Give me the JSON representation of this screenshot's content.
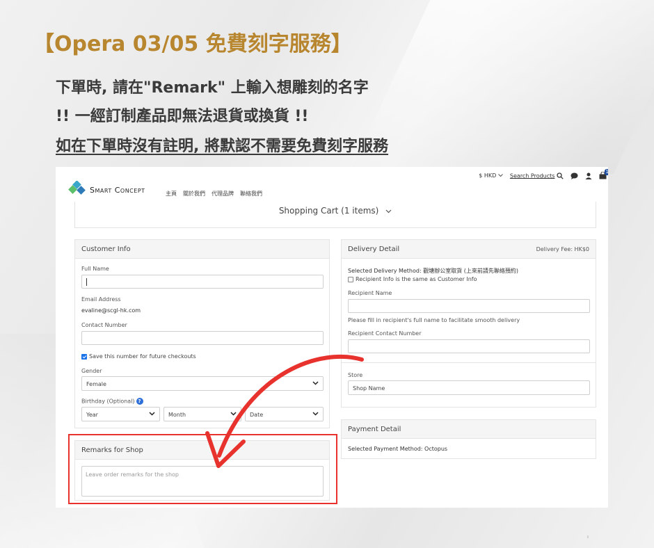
{
  "title": "【Opera 03/05 免費刻字服務】",
  "instructions": {
    "line1": "下單時, 請在\"Remark\" 上輸入想雕刻的名字",
    "line2": "!! 一經訂制產品即無法退貨或換貨 !!",
    "line3": "如在下單時沒有註明, 將默認不需要免費刻字服務 "
  },
  "store": {
    "brand": "Smart Concept",
    "nav": [
      "主頁",
      "關於我們",
      "代理品牌",
      "聯絡我們"
    ],
    "currency": "$ HKD",
    "search_label": "Search Products",
    "cart_count": "1",
    "cart_bar": "Shopping Cart (1 items)"
  },
  "customer_info": {
    "heading": "Customer Info",
    "full_name_label": "Full Name",
    "email_label": "Email Address",
    "email_value": "evaline@scgl-hk.com",
    "contact_label": "Contact Number",
    "save_number_label": "Save this number for future checkouts",
    "gender_label": "Gender",
    "gender_value": "Female",
    "birthday_label": "Birthday (Optional)",
    "birthday_year": "Year",
    "birthday_month": "Month",
    "birthday_date": "Date"
  },
  "remarks": {
    "heading": "Remarks for Shop",
    "placeholder": "Leave order remarks for the shop"
  },
  "delivery": {
    "heading": "Delivery Detail",
    "fee": "Delivery Fee: HK$0",
    "method": "Selected Delivery Method: 觀塘辦公室取貨 (上來前請先聯絡預約)",
    "same_as_customer": "Recipient Info is the same as Customer Info",
    "recipient_name_label": "Recipient Name",
    "recipient_hint": "Please fill in recipient's full name to facilitate smooth delivery",
    "recipient_contact_label": "Recipient Contact Number",
    "store_label": "Store",
    "store_value": "Shop Name"
  },
  "payment": {
    "heading": "Payment Detail",
    "method": "Selected Payment Method: Octopus"
  },
  "colors": {
    "headline": "#b8862e",
    "instruction": "#3a3a3a",
    "highlight": "#e8322d"
  }
}
